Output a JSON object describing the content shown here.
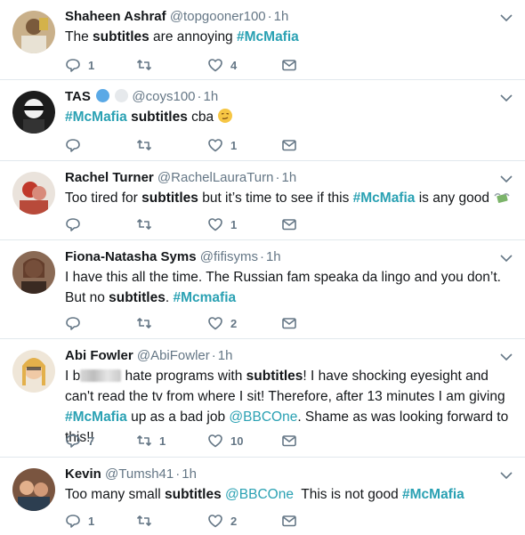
{
  "colors": {
    "name": "#14171a",
    "meta": "#657786",
    "hashtag": "#2aa1b3",
    "divider": "#e1e8ed"
  },
  "tweets": [
    {
      "name": "Shaheen Ashraf",
      "handle": "@topgooner100",
      "time": "1h",
      "text": {
        "t1": "The ",
        "b1": "subtitles",
        "t2": " are annoying ",
        "h1": "#McMafia"
      },
      "replies": "1",
      "retweets": "",
      "likes": "4"
    },
    {
      "name": "TAS",
      "handle": "@coys100",
      "time": "1h",
      "text": {
        "h1": "#McMafia",
        "t1": " ",
        "b1": "subtitles",
        "t2": " cba "
      },
      "emoji": "smirk-face-emoji",
      "replies": "",
      "retweets": "",
      "likes": "1"
    },
    {
      "name": "Rachel Turner",
      "handle": "@RachelLauraTurn",
      "time": "1h",
      "text": {
        "t1": "Too tired for ",
        "b1": "subtitles",
        "t2": " but it’s time to see if this ",
        "h1": "#McMafia",
        "t3": " is any good "
      },
      "emoji": "money-with-wings-emoji",
      "replies": "",
      "retweets": "",
      "likes": "1"
    },
    {
      "name": "Fiona-Natasha Syms",
      "handle": "@fifisyms",
      "time": "1h",
      "text": {
        "t1": "I have this all the time. The Russian fam speaka da lingo and you don’t. But no ",
        "b1": "subtitles",
        "t2": ". ",
        "h1": "#Mcmafia"
      },
      "replies": "",
      "retweets": "",
      "likes": "2"
    },
    {
      "name": "Abi Fowler",
      "handle": "@AbiFowler",
      "time": "1h",
      "text": {
        "t0": "I b",
        "t1": " hate programs with ",
        "b1": "subtitles",
        "t2": "! I have shocking eyesight and can't read the tv from where I sit! Therefore, after 13 minutes I am giving ",
        "h1": "#McMafia",
        "t3": " up as a bad job ",
        "m1": "@BBCOne",
        "t4": ". Shame as was looking forward to this!!"
      },
      "replies": "7",
      "retweets": "1",
      "likes": "10"
    },
    {
      "name": "Kevin",
      "handle": "@Tumsh41",
      "time": "1h",
      "text": {
        "t1": "Too many small ",
        "b1": "subtitles",
        "t2": " ",
        "m1": "@BBCOne",
        "t3": "  This is not good ",
        "h1": "#McMafia"
      },
      "replies": "1",
      "retweets": "",
      "likes": "2"
    }
  ]
}
